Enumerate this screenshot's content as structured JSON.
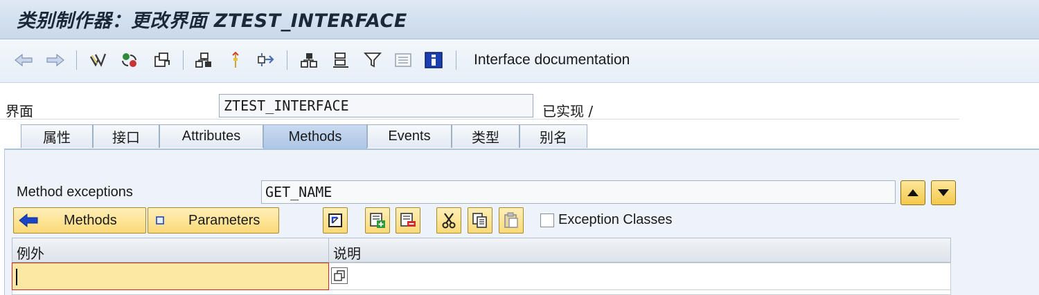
{
  "window": {
    "title": "类别制作器：更改界面 ZTEST_INTERFACE"
  },
  "toolbar": {
    "icons": [
      "back-arrow-icon",
      "forward-arrow-icon",
      "check-icon",
      "activate-icon",
      "where-used-icon",
      "hierarchy-icon",
      "pointer-icon",
      "navigate-icon",
      "object-list-icon",
      "structure-icon",
      "filter-icon",
      "list-icon",
      "info-icon"
    ],
    "documentation_label": "Interface documentation"
  },
  "header": {
    "interface_label": "界面",
    "interface_value": "ZTEST_INTERFACE",
    "status": "已实现 /"
  },
  "tabs": [
    {
      "label": "属性",
      "active": false
    },
    {
      "label": "接口",
      "active": false
    },
    {
      "label": "Attributes",
      "active": false
    },
    {
      "label": "Methods",
      "active": true
    },
    {
      "label": "Events",
      "active": false
    },
    {
      "label": "类型",
      "active": false
    },
    {
      "label": "别名",
      "active": false
    }
  ],
  "method_exceptions": {
    "label": "Method exceptions",
    "value": "GET_NAME",
    "methods_button": "Methods",
    "parameters_button": "Parameters",
    "exception_classes_label": "Exception Classes",
    "exception_classes_checked": false
  },
  "grid": {
    "columns": [
      "例外",
      "说明"
    ],
    "rows": [
      {
        "exception": "",
        "description": ""
      }
    ]
  },
  "colors": {
    "title_bg": "#c9d8ea",
    "active_tab": "#adc6e6",
    "button_yellow": "#fbd978",
    "input_highlight": "#fce8a3",
    "required_border": "#d61f1f"
  }
}
